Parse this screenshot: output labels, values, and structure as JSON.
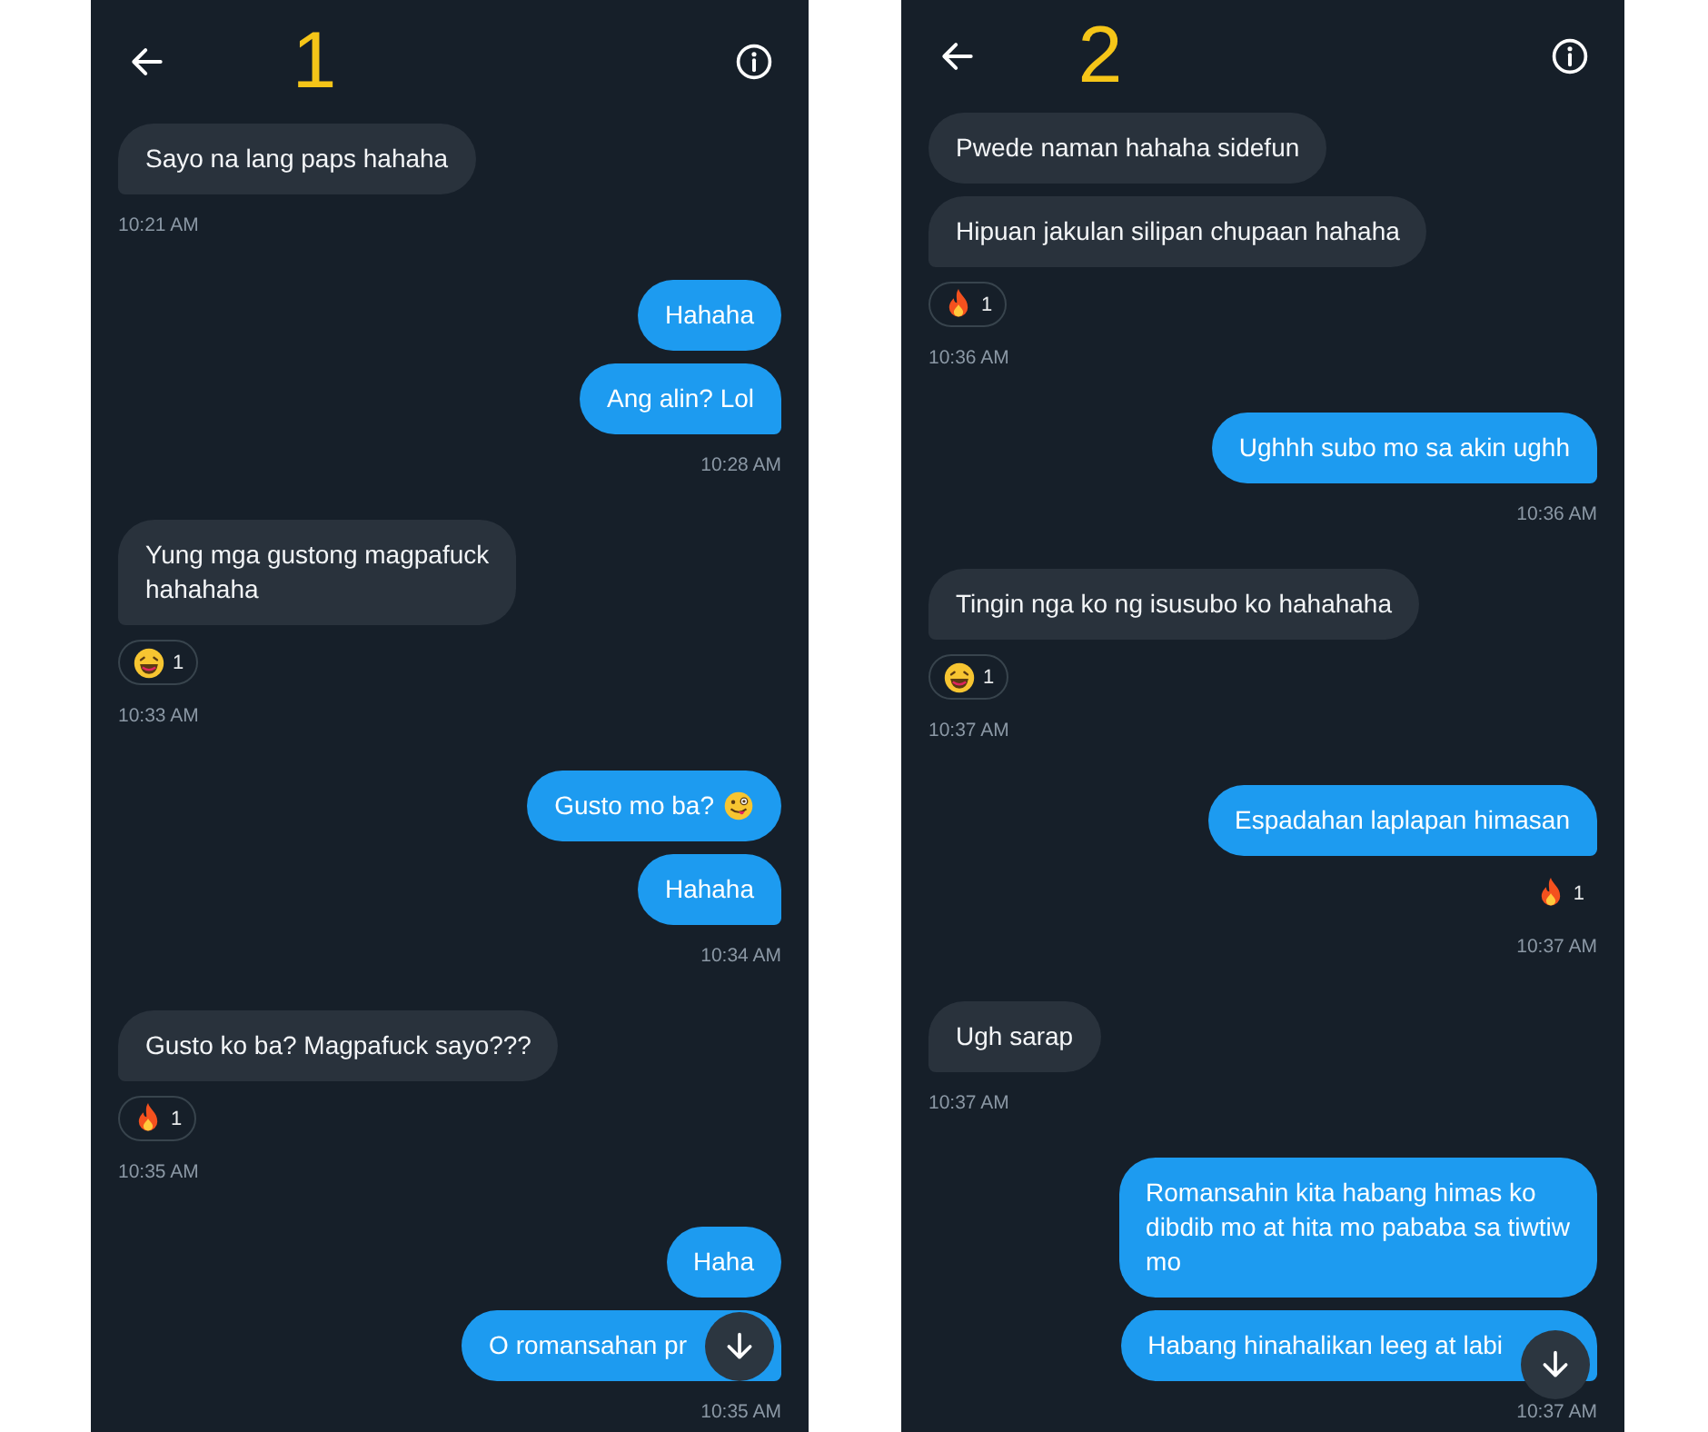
{
  "panels": [
    {
      "label": "1",
      "groups": [
        {
          "kind": "received",
          "bubbles": [
            {
              "text": "Sayo na lang paps hahaha"
            }
          ],
          "time": "10:21 AM"
        },
        {
          "kind": "sent",
          "bubbles": [
            {
              "text": "Hahaha"
            },
            {
              "text": "Ang alin? Lol"
            }
          ],
          "time": "10:28 AM"
        },
        {
          "kind": "received",
          "bubbles": [
            {
              "text": "Yung mga gustong magpafuck\nhahahaha"
            }
          ],
          "reaction": {
            "kind": "laugh",
            "count": "1"
          },
          "time": "10:33 AM"
        },
        {
          "kind": "sent",
          "bubbles": [
            {
              "text": "Gusto mo ba?",
              "kind": "with_silly_face"
            },
            {
              "text": "Hahaha"
            }
          ],
          "time": "10:34 AM"
        },
        {
          "kind": "received",
          "bubbles": [
            {
              "text": "Gusto ko ba? Magpafuck sayo???"
            }
          ],
          "reaction": {
            "kind": "fire",
            "count": "1"
          },
          "time": "10:35 AM"
        },
        {
          "kind": "sent",
          "bubbles": [
            {
              "text": "Haha"
            },
            {
              "text": "O romansahan pr"
            }
          ],
          "time": "10:35 AM"
        }
      ]
    },
    {
      "label": "2",
      "groups": [
        {
          "kind": "received",
          "bubbles": [
            {
              "text": "Pwede naman hahaha sidefun"
            },
            {
              "text": "Hipuan jakulan silipan chupaan hahaha"
            }
          ],
          "reaction": {
            "kind": "fire",
            "count": "1"
          },
          "time": "10:36 AM"
        },
        {
          "kind": "sent",
          "bubbles": [
            {
              "text": "Ughhh subo mo sa akin ughh"
            }
          ],
          "time": "10:36 AM"
        },
        {
          "kind": "received",
          "bubbles": [
            {
              "text": "Tingin nga ko ng isusubo ko hahahaha"
            }
          ],
          "reaction": {
            "kind": "laugh",
            "count": "1"
          },
          "time": "10:37 AM"
        },
        {
          "kind": "sent",
          "bubbles": [
            {
              "text": "Espadahan laplapan himasan"
            }
          ],
          "reaction": {
            "kind": "fire",
            "count": "1"
          },
          "time": "10:37 AM"
        },
        {
          "kind": "received",
          "bubbles": [
            {
              "text": "Ugh sarap"
            }
          ],
          "time": "10:37 AM"
        },
        {
          "kind": "sent",
          "bubbles": [
            {
              "text": "Romansahin kita habang himas ko\ndibdib mo at hita mo pababa sa tiwtiw\nmo"
            },
            {
              "text": "Habang hinahalikan leeg at labi"
            }
          ],
          "time": "10:37 AM"
        }
      ]
    }
  ]
}
